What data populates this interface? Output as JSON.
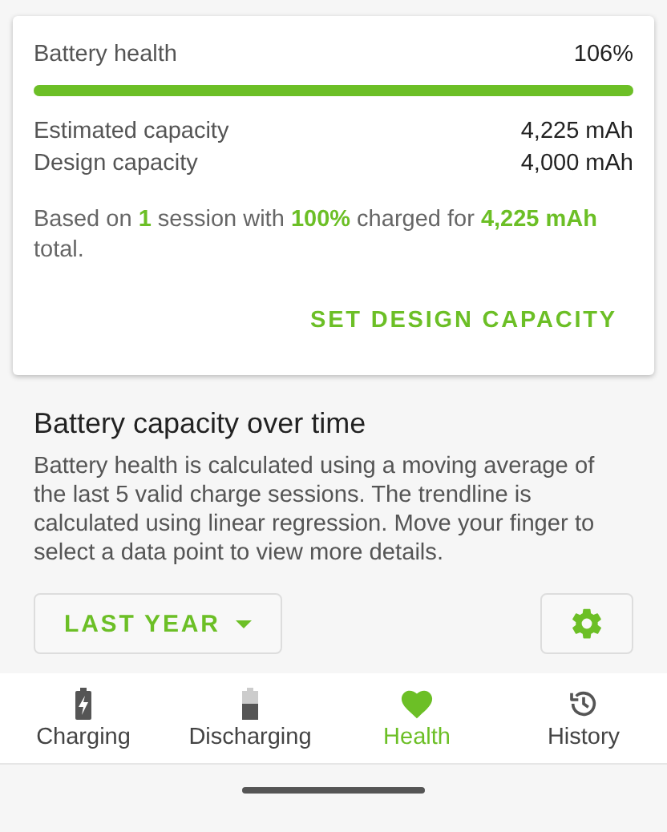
{
  "health_card": {
    "label": "Battery health",
    "value": "106%",
    "level": 1,
    "rows": [
      {
        "label": "Estimated capacity",
        "value": "4,225 mAh"
      },
      {
        "label": "Design capacity",
        "value": "4,000 mAh"
      }
    ],
    "summary": "Based on **1** session with **100%** charged for **4,225 mAh** total.",
    "action": "SET DESIGN CAPACITY"
  },
  "section": {
    "title": "Battery capacity over time",
    "description": "Battery health is calculated using a moving average of the last 5 valid charge sessions. The trendline is calculated using linear regression. Move your finger to select a data point to view more details.",
    "range": "LAST YEAR"
  },
  "nav": [
    {
      "label": "Charging",
      "kind": "charging",
      "selected": false
    },
    {
      "label": "Discharging",
      "kind": "discharging",
      "selected": false
    },
    {
      "label": "Health",
      "kind": "health",
      "selected": true
    },
    {
      "label": "History",
      "kind": "history",
      "selected": false
    }
  ]
}
